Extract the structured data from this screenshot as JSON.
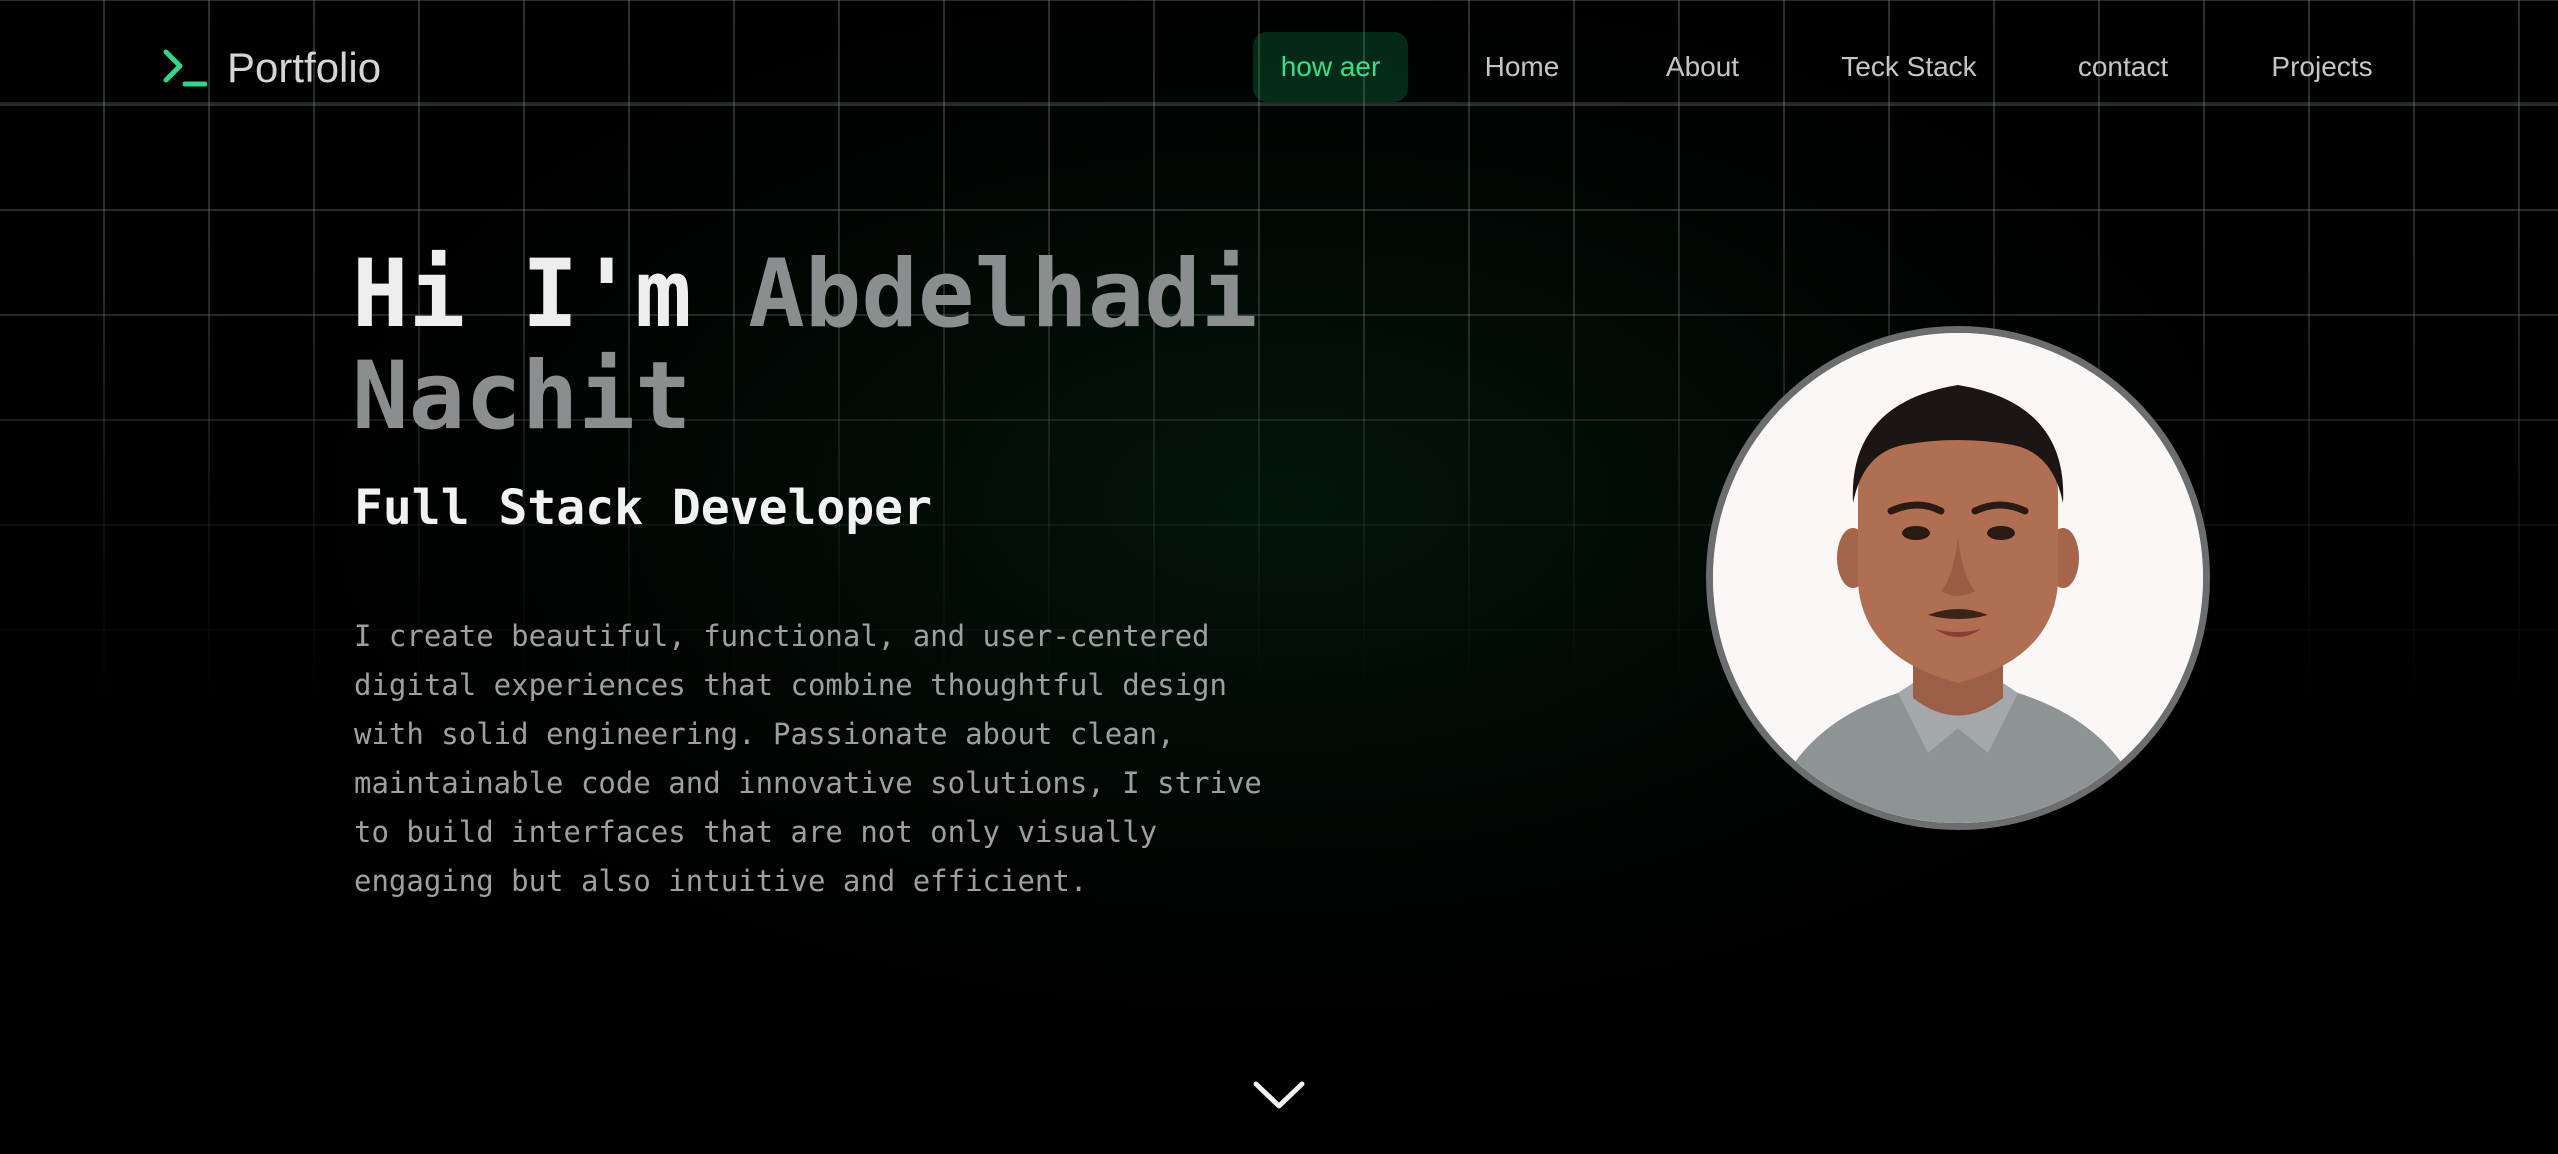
{
  "brand": {
    "name": "Portfolio",
    "icon": "terminal-prompt-icon"
  },
  "nav": {
    "items": [
      {
        "label": "how aer",
        "active": true
      },
      {
        "label": "Home",
        "active": false
      },
      {
        "label": "About",
        "active": false
      },
      {
        "label": "Teck Stack",
        "active": false
      },
      {
        "label": "contact",
        "active": false
      },
      {
        "label": "Projects",
        "active": false
      }
    ]
  },
  "hero": {
    "greeting": "Hi I'm",
    "name_first": "Abdelhadi",
    "name_last": "Nachit",
    "role": "Full Stack Developer",
    "description": "I create beautiful, functional, and user-centered digital experiences that combine thoughtful design with solid engineering. Passionate about clean, maintainable code and innovative solutions, I strive to build interfaces that are not only visually engaging but also intuitive and efficient."
  },
  "scroll": {
    "icon": "chevron-down-icon"
  },
  "colors": {
    "accent": "#35e08a",
    "background": "#000000",
    "name_gray": "#8a8e8f"
  }
}
